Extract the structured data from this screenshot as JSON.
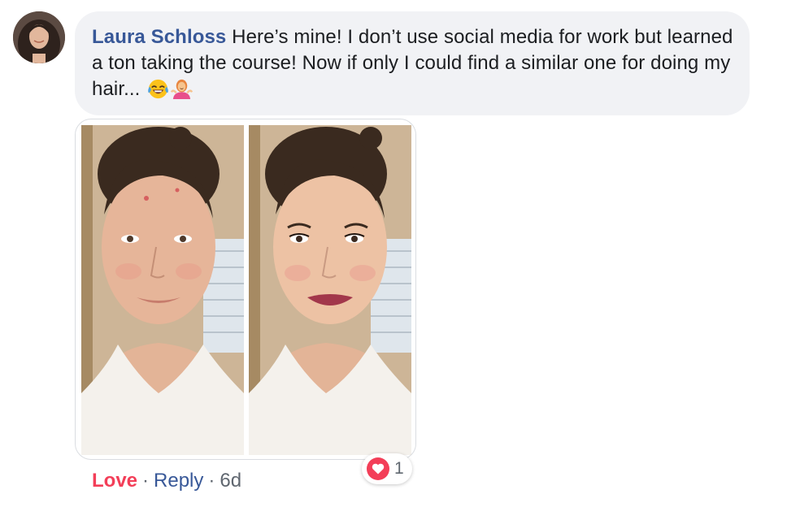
{
  "comment": {
    "author": "Laura Schloss",
    "text": " Here’s mine! I don’t use social media for work but learned a ton taking the course! Now if only I could find a similar one for doing my hair...",
    "emojis": [
      "tears-of-joy-emoji",
      "woman-shrugging-emoji"
    ]
  },
  "attachment": {
    "photos": [
      {
        "name": "before-photo",
        "icon": "face-without-makeup"
      },
      {
        "name": "after-photo",
        "icon": "face-with-makeup"
      }
    ]
  },
  "actions": {
    "love_label": "Love",
    "reply_label": "Reply",
    "separator": "·",
    "timestamp": "6d"
  },
  "reaction": {
    "icon": "heart-icon",
    "count": "1",
    "color": "#f33e58"
  },
  "colors": {
    "author": "#385898",
    "bubble": "#f1f2f5",
    "love": "#f33e58",
    "meta": "#606770"
  }
}
